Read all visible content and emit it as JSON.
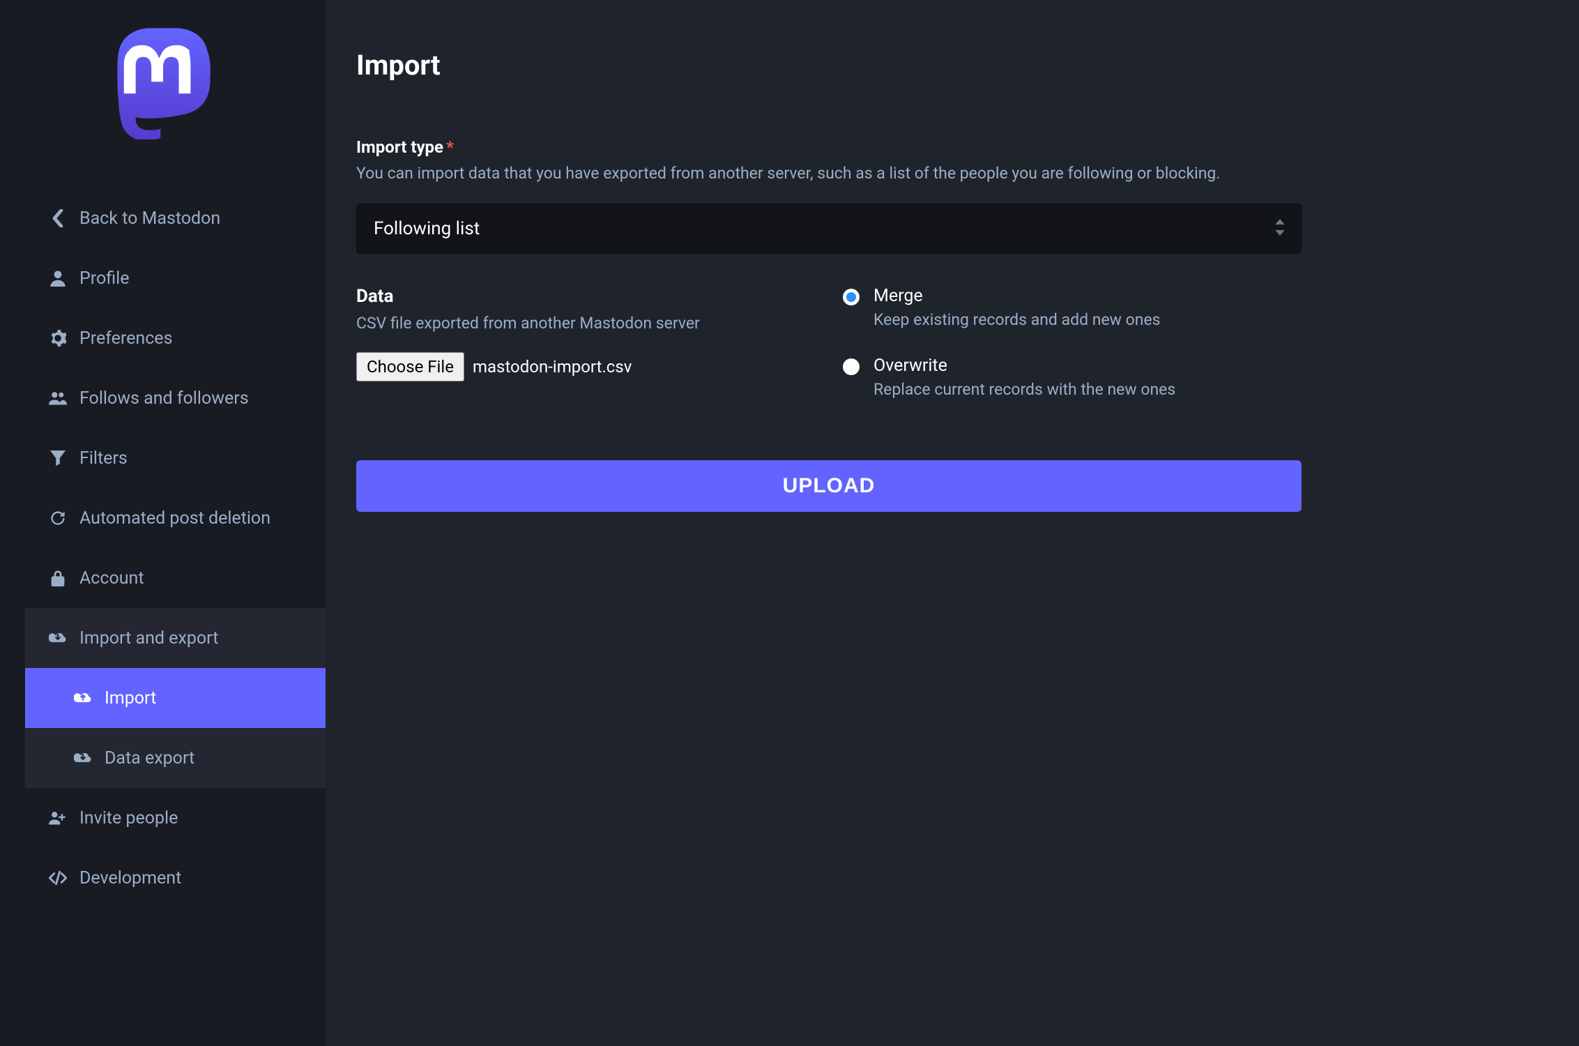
{
  "sidebar": {
    "items": [
      {
        "label": "Back to Mastodon",
        "icon": "chevron-left"
      },
      {
        "label": "Profile",
        "icon": "user"
      },
      {
        "label": "Preferences",
        "icon": "gear"
      },
      {
        "label": "Follows and followers",
        "icon": "users"
      },
      {
        "label": "Filters",
        "icon": "filter"
      },
      {
        "label": "Automated post deletion",
        "icon": "history"
      },
      {
        "label": "Account",
        "icon": "lock"
      }
    ],
    "group": {
      "label": "Import and export",
      "icon": "cloud-down",
      "sub": [
        {
          "label": "Import",
          "icon": "cloud-up",
          "active": true
        },
        {
          "label": "Data export",
          "icon": "cloud-down",
          "active": false
        }
      ]
    },
    "items_after": [
      {
        "label": "Invite people",
        "icon": "user-plus"
      },
      {
        "label": "Development",
        "icon": "code"
      }
    ]
  },
  "page": {
    "title": "Import",
    "import_type_label": "Import type",
    "import_type_desc": "You can import data that you have exported from another server, such as a list of the people you are following or blocking.",
    "import_type_value": "Following list",
    "data_label": "Data",
    "data_desc": "CSV file exported from another Mastodon server",
    "file_button": "Choose File",
    "file_name": "mastodon-import.csv",
    "modes": [
      {
        "title": "Merge",
        "desc": "Keep existing records and add new ones",
        "checked": true
      },
      {
        "title": "Overwrite",
        "desc": "Replace current records with the new ones",
        "checked": false
      }
    ],
    "upload_label": "UPLOAD"
  }
}
